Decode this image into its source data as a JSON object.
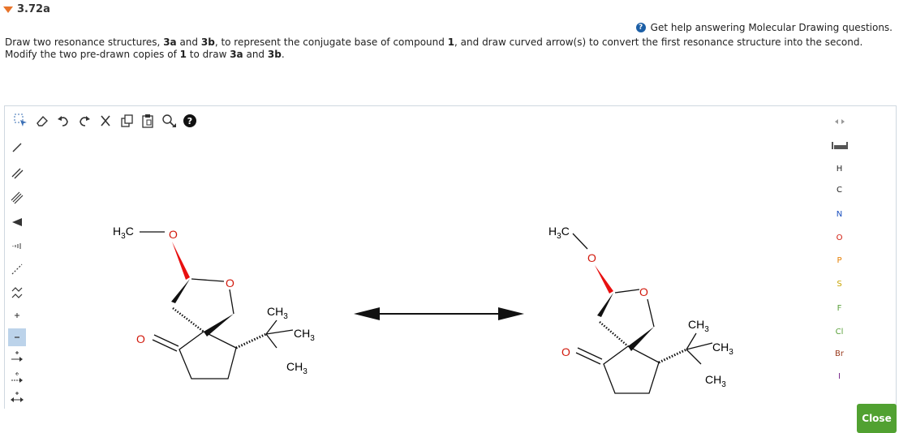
{
  "question": {
    "id": "3.72a"
  },
  "help": {
    "text": "Get help answering Molecular Drawing questions."
  },
  "instructions": {
    "p1": "Draw two resonance structures, ",
    "b1": "3a",
    "p2": " and ",
    "b2": "3b",
    "p3": ", to represent the conjugate base of compound ",
    "b3": "1",
    "p4": ", and draw curved arrow(s) to convert the first resonance structure into the second.",
    "p5": "Modify the two pre-drawn copies of ",
    "b4": "1",
    "p6": " to draw ",
    "b5": "3a",
    "p7": " and ",
    "b6": "3b",
    "p8": "."
  },
  "toolbar": {
    "icons": [
      "select-icon",
      "eraser-icon",
      "undo-icon",
      "redo-icon",
      "cut-icon",
      "copy-icon",
      "paste-icon",
      "zoom-icon",
      "help-icon"
    ]
  },
  "left_tools": [
    "single-bond",
    "double-bond",
    "triple-bond",
    "wedge-bond",
    "hash-bond",
    "dashed-bond",
    "chain",
    "positive-charge",
    "negative-charge",
    "single-arrow",
    "double-arrow",
    "electron-push",
    "more"
  ],
  "elements": [
    "H",
    "C",
    "N",
    "O",
    "P",
    "S",
    "F",
    "Cl",
    "Br",
    "I"
  ],
  "element_colors": {
    "H": "#222",
    "C": "#222",
    "N": "#1a4fbf",
    "O": "#d1180b",
    "P": "#e67e00",
    "S": "#c9a400",
    "F": "#5aa13b",
    "Cl": "#5aa13b",
    "Br": "#9a3b1e",
    "I": "#7a2a8a"
  },
  "close_button": {
    "label": "Close",
    "color": "#51a131"
  },
  "molecule": {
    "methyl_h": "H",
    "methyl_3": "3",
    "methyl_c": "C",
    "o": "O",
    "ch": "CH",
    "three": "3"
  },
  "colors": {
    "accent": "#e8742a",
    "help_icon": "#1c5fa6",
    "red_wedge": "#e81010"
  }
}
